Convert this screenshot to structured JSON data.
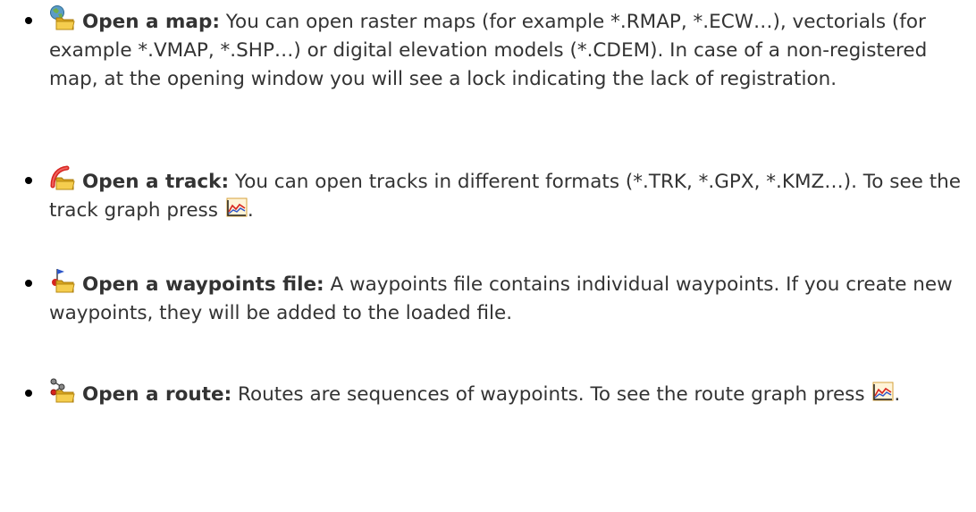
{
  "items": [
    {
      "icon": "open-map-icon",
      "heading": "Open a map:",
      "body": " You can open raster maps (for example *.RMAP, *.ECW…), vectorials (for example *.VMAP, *.SHP…) or digital elevation models (*.CDEM). In case of a non-registered map, at the opening window you will see a lock indicating the lack of registration."
    },
    {
      "icon": "open-track-icon",
      "heading": "Open a track:",
      "body": " You can open tracks in different formats (*.TRK, *.GPX, *.KMZ…). To see the track graph press ",
      "trailing_icon": "graph-icon",
      "tail": "."
    },
    {
      "icon": "open-waypoints-icon",
      "heading": "Open a waypoints file:",
      "body": " A waypoints file contains individual waypoints. If you create new waypoints, they will be added to the loaded file."
    },
    {
      "icon": "open-route-icon",
      "heading": "Open a route:",
      "body": " Routes are sequences of waypoints. To see the route graph press ",
      "trailing_icon": "graph-icon",
      "tail": "."
    }
  ]
}
